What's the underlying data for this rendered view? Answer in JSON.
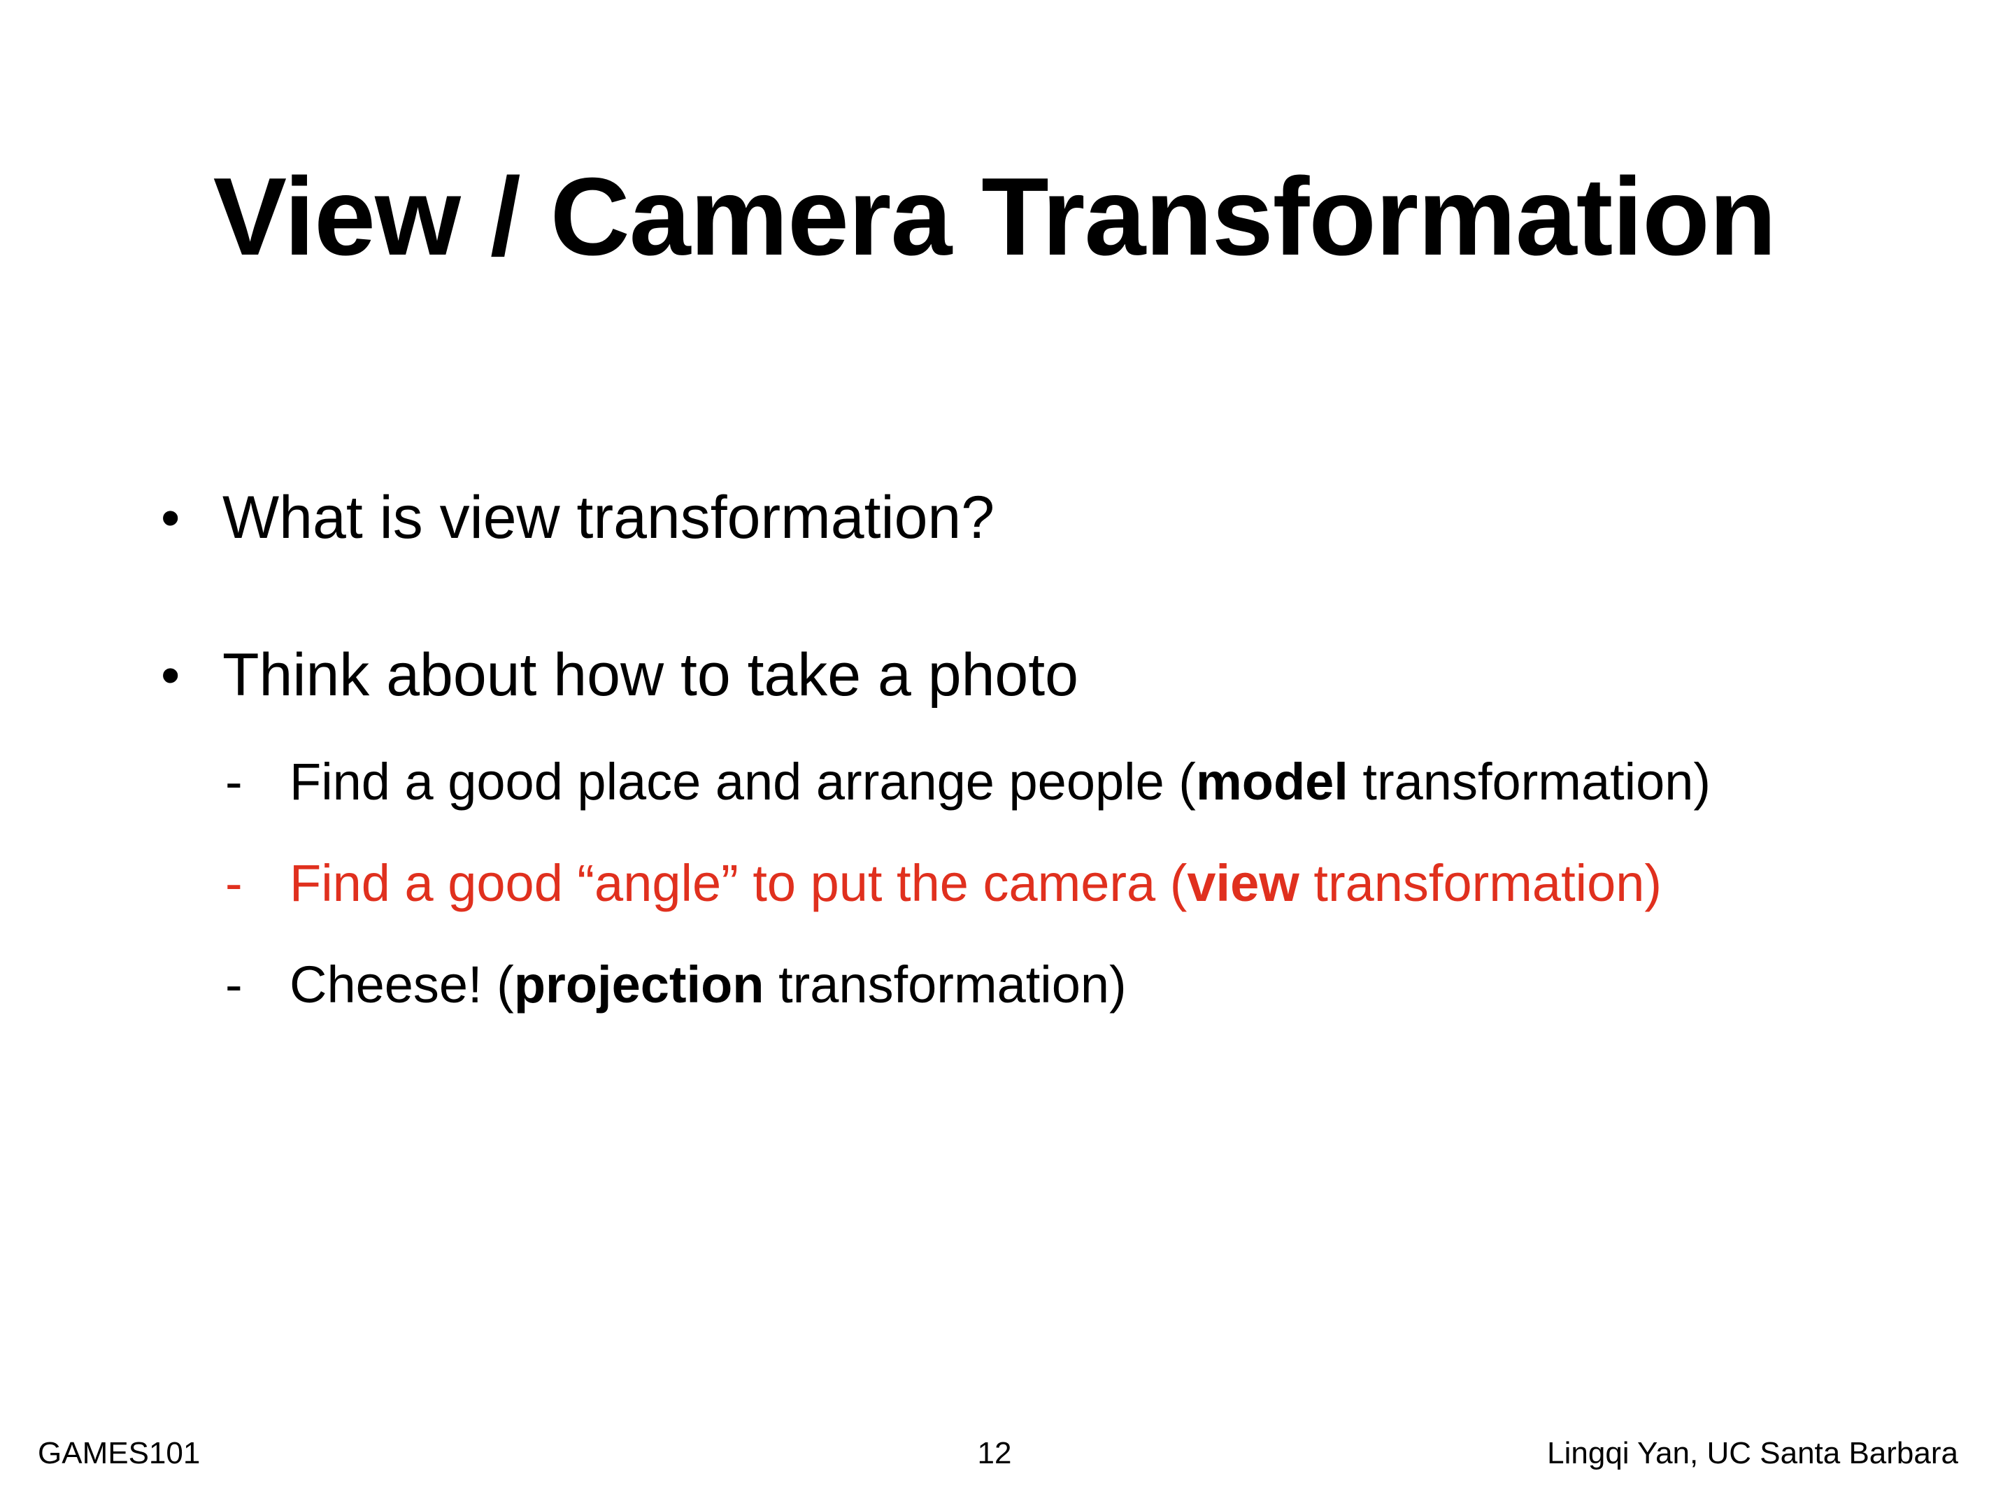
{
  "slide": {
    "title": "View / Camera Transformation",
    "bullets": [
      {
        "marker": "•",
        "text": "What is view transformation?"
      },
      {
        "marker": "•",
        "text": "Think about how to take a photo"
      }
    ],
    "subitems": [
      {
        "marker": "-",
        "before": "Find a good place and arrange people (",
        "bold": "model",
        "after": " transformation)",
        "color": "#000000"
      },
      {
        "marker": "-",
        "before": "Find a good “angle” to put the camera (",
        "bold": "view",
        "after": " transformation)",
        "color": "#e0301e"
      },
      {
        "marker": "-",
        "before": "Cheese! (",
        "bold": "projection",
        "after": " transformation)",
        "color": "#000000"
      }
    ],
    "footer": {
      "left": "GAMES101",
      "page_number": "12",
      "right": "Lingqi Yan, UC Santa Barbara"
    }
  }
}
